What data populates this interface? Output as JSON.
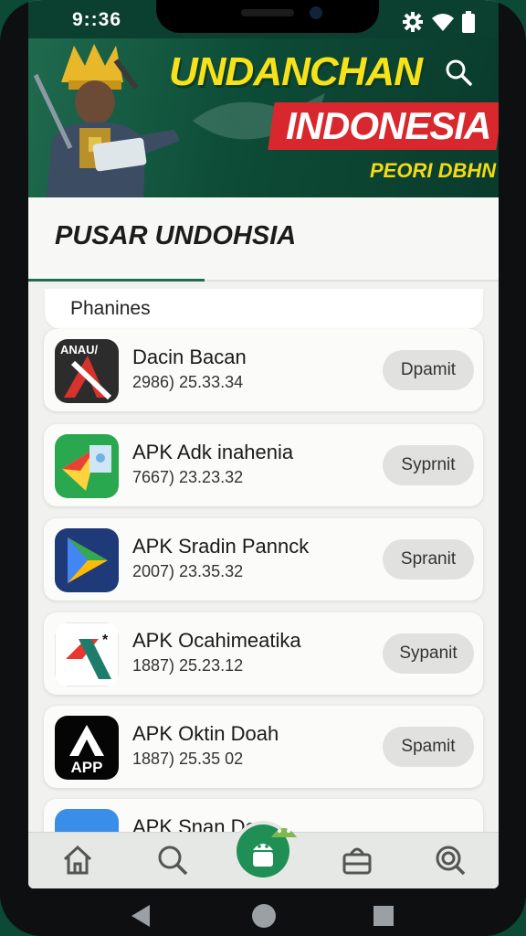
{
  "status": {
    "time": "9::36"
  },
  "banner": {
    "title": "UNDANCHAN",
    "subtitle": "INDONESIA",
    "link": "PEORI DBHN"
  },
  "section": {
    "title": "PUSAR UNDOHSIA"
  },
  "list_header": "Phanines",
  "apps": [
    {
      "name": "Dacin Bacan",
      "meta": "2986) 25.33.34",
      "button": "Dpamit",
      "icon": "anau-app-icon",
      "icon_text": "ANAU/"
    },
    {
      "name": "APK Adk inahenia",
      "meta": "7667) 23.23.32",
      "button": "Syprnit",
      "icon": "play-games-app-icon"
    },
    {
      "name": "APK Sradin Pannck",
      "meta": "2007) 23.35.32",
      "button": "Spranit",
      "icon": "play-store-app-icon"
    },
    {
      "name": "APK Ocahimeatika",
      "meta": "1887) 25.23.12",
      "button": "Sypanit",
      "icon": "ocahimeatika-app-icon"
    },
    {
      "name": "APK Oktin Doah",
      "meta": "1887) 25.35 02",
      "button": "Spamit",
      "icon": "app-app-icon",
      "icon_text": "APP"
    },
    {
      "name": "APK Snan Doc",
      "meta": "",
      "button": "",
      "icon": "android-app-icon"
    }
  ],
  "bottom_nav": [
    "home-icon",
    "search-icon",
    "android-icon",
    "store-icon",
    "discover-icon"
  ],
  "colors": {
    "brand_green": "#0b3f2f",
    "accent_yellow": "#f7e21a",
    "accent_red": "#d9272e",
    "nav_active": "#1f8f55"
  }
}
